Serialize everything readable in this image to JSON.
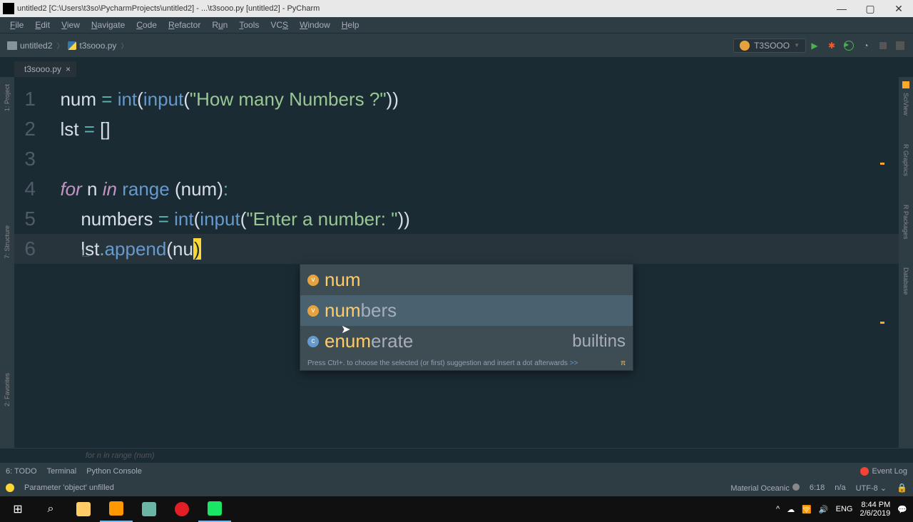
{
  "title": "untitled2 [C:\\Users\\t3so\\PycharmProjects\\untitled2] - ...\\t3sooo.py [untitled2] - PyCharm",
  "menu": [
    "File",
    "Edit",
    "View",
    "Navigate",
    "Code",
    "Refactor",
    "Run",
    "Tools",
    "VCS",
    "Window",
    "Help"
  ],
  "breadcrumbs": {
    "project": "untitled2",
    "file": "t3sooo.py"
  },
  "run_config": "T3SOOO",
  "tab": {
    "name": "t3sooo.py"
  },
  "lines": [
    "1",
    "2",
    "3",
    "4",
    "5",
    "6"
  ],
  "context_hint": "for n in range (num)",
  "popup": {
    "items": [
      {
        "match": "num",
        "rest": "",
        "kind": "var"
      },
      {
        "match": "num",
        "rest": "bers",
        "kind": "var"
      },
      {
        "match": "enum",
        "rest": "erate",
        "right": "builtins",
        "kind": "builtin"
      }
    ],
    "hint": "Press Ctrl+. to choose the selected (or first) suggestion and insert a dot afterwards",
    "hint_link": ">>"
  },
  "left_tools": {
    "project": "1: Project",
    "structure": "7: Structure",
    "favorites": "2: Favorites"
  },
  "right_tools": {
    "sciview": "SciView",
    "database": "Database",
    "rgraphics": "R Graphics",
    "rpackages": "R Packages"
  },
  "bottom_tools": {
    "todo": "6: TODO",
    "terminal": "Terminal",
    "pyconsole": "Python Console",
    "eventlog": "Event Log"
  },
  "status": {
    "inspection": "Parameter 'object' unfilled",
    "theme": "Material Oceanic",
    "pos": "6:18",
    "sep": "n/a",
    "enc": "UTF-8",
    "lock": "🔒"
  },
  "tray": {
    "chev": "^",
    "cloud": "☁",
    "wifi": "🛜",
    "sound": "🔊",
    "lang": "ENG",
    "time": "8:44 PM",
    "date": "2/6/2019",
    "notif": "💬"
  }
}
